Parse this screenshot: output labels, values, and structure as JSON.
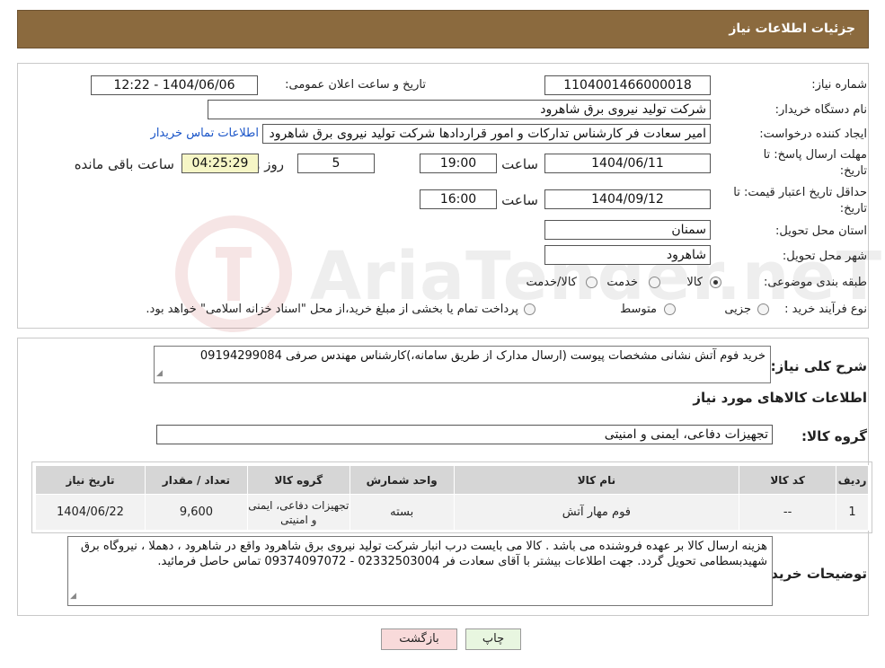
{
  "header": {
    "title": "جزئیات اطلاعات نیاز"
  },
  "fields": {
    "need_number_label": "شماره نیاز:",
    "need_number": "1104001466000018",
    "announce_label": "تاریخ و ساعت اعلان عمومی:",
    "announce_value": "1404/06/06 - 12:22",
    "buyer_org_label": "نام دستگاه خریدار:",
    "buyer_org": "شرکت تولید نیروی برق شاهرود",
    "creator_label": "ایجاد کننده درخواست:",
    "creator": "امیر سعادت فر کارشناس تدارکات و امور قراردادها شرکت تولید نیروی برق شاهرود",
    "contact_link": "اطلاعات تماس خریدار",
    "deadline_label_1": "مهلت ارسال پاسخ: تا",
    "deadline_label_2": "تاریخ:",
    "deadline_date": "1404/06/11",
    "time_label": "ساعت",
    "deadline_time": "19:00",
    "days_value": "5",
    "days_label": "روز و",
    "remaining_time": "04:25:29",
    "remaining_label": "ساعت باقی مانده",
    "validity_label_1": "حداقل تاریخ اعتبار قیمت: تا",
    "validity_label_2": "تاریخ:",
    "validity_date": "1404/09/12",
    "validity_time": "16:00",
    "province_label": "استان محل تحویل:",
    "province": "سمنان",
    "city_label": "شهر محل تحویل:",
    "city": "شاهرود",
    "category_label": "طبقه بندی موضوعی:",
    "category_options": [
      "کالا",
      "خدمت",
      "کالا/خدمت"
    ],
    "category_selected": 0,
    "process_label": "نوع فرآیند خرید :",
    "process_options": [
      "جزیی",
      "متوسط"
    ],
    "process_note": "پرداخت تمام یا بخشی از مبلغ خرید،از محل \"اسناد خزانه اسلامی\" خواهد بود."
  },
  "summary": {
    "label": "شرح کلی نیاز:",
    "text": "خرید فوم آتش نشانی مشخصات پیوست (ارسال مدارک از طریق سامانه،)کارشناس مهندس صرفی 09194299084"
  },
  "goods": {
    "section_title": "اطلاعات کالاهای مورد نیاز",
    "group_label": "گروه کالا:",
    "group_value": "تجهیزات دفاعی، ایمنی و امنیتی",
    "columns": [
      "ردیف",
      "کد کالا",
      "نام کالا",
      "واحد شمارش",
      "گروه کالا",
      "تعداد / مقدار",
      "تاریخ نیاز"
    ],
    "rows": [
      {
        "row": "1",
        "code": "--",
        "name": "فوم مهار آتش",
        "unit": "بسته",
        "group": "تجهیزات دفاعی، ایمنی و امنیتی",
        "qty": "9,600",
        "date": "1404/06/22"
      }
    ]
  },
  "buyer_notes": {
    "label": "توضیحات خریدار:",
    "text": "هزینه ارسال کالا بر عهده فروشنده می باشد . کالا می بایست درب انبار شرکت تولید نیروی برق شاهرود واقع در شاهرود ، دهملا ، نیروگاه برق شهیدبسطامی تحویل گردد. جهت اطلاعات بیشتر با آقای سعادت فر  02332503004 - 09374097072 تماس حاصل فرمائید."
  },
  "buttons": {
    "print": "چاپ",
    "back": "بازگشت"
  },
  "watermark": {
    "text": "AriaTender.neT"
  },
  "colors": {
    "header": "#8b6a3e",
    "link": "#1a55c8",
    "print_bg": "#e8f6e0",
    "back_bg": "#f8dada"
  }
}
